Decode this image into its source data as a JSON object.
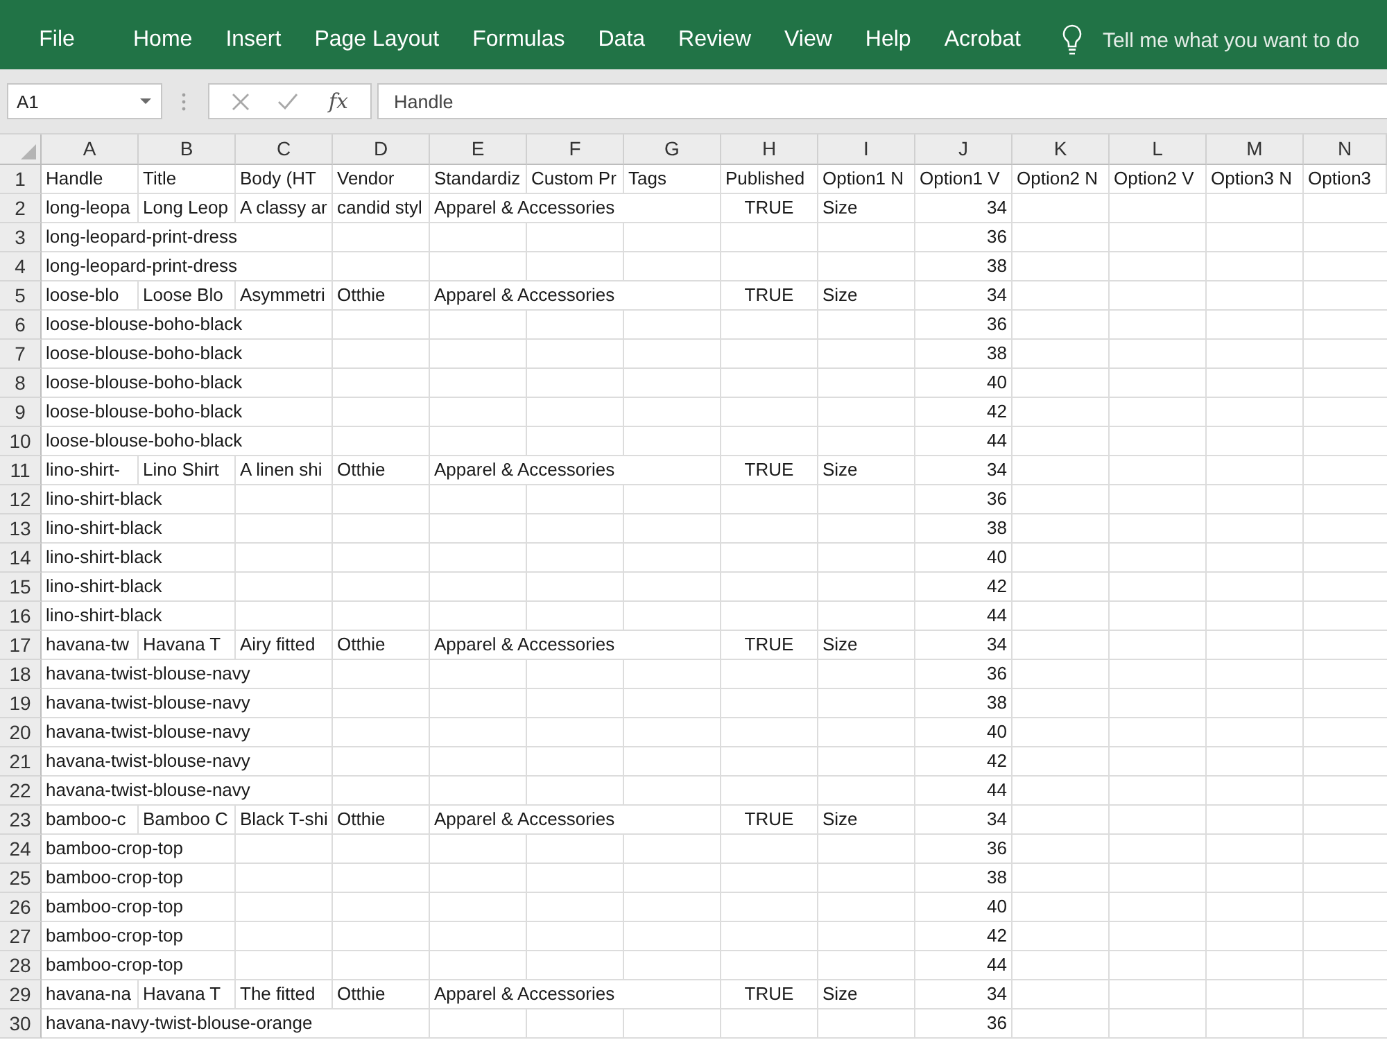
{
  "ribbon": {
    "tabs": [
      "File",
      "Home",
      "Insert",
      "Page Layout",
      "Formulas",
      "Data",
      "Review",
      "View",
      "Help",
      "Acrobat"
    ],
    "tell_me": {
      "placeholder": "Tell me what you want to do"
    }
  },
  "formula_bar": {
    "name_box": "A1",
    "function_label": "fx",
    "formula": "Handle"
  },
  "sheet": {
    "columns": [
      "A",
      "B",
      "C",
      "D",
      "E",
      "F",
      "G",
      "H",
      "I",
      "J",
      "K",
      "L",
      "M",
      "N"
    ],
    "rows": [
      {
        "number": "1",
        "cells": {
          "A": {
            "text": "Handle",
            "kind": "text"
          },
          "B": {
            "text": "Title",
            "kind": "text"
          },
          "C": {
            "text": "Body (HT",
            "kind": "text"
          },
          "D": {
            "text": "Vendor",
            "kind": "text"
          },
          "E": {
            "text": "Standardiz",
            "kind": "text"
          },
          "F": {
            "text": "Custom Pr",
            "kind": "text"
          },
          "G": {
            "text": "Tags",
            "kind": "text"
          },
          "H": {
            "text": "Published",
            "kind": "text"
          },
          "I": {
            "text": "Option1 N",
            "kind": "text"
          },
          "J": {
            "text": "Option1 V",
            "kind": "text"
          },
          "K": {
            "text": "Option2 N",
            "kind": "text"
          },
          "L": {
            "text": "Option2 V",
            "kind": "text"
          },
          "M": {
            "text": "Option3 N",
            "kind": "text"
          },
          "N": {
            "text": "Option3",
            "kind": "text"
          }
        }
      },
      {
        "number": "2",
        "cells": {
          "A": {
            "text": "long-leopa",
            "kind": "text"
          },
          "B": {
            "text": "Long Leop",
            "kind": "text"
          },
          "C": {
            "text": "A classy ar",
            "kind": "text"
          },
          "D": {
            "text": "candid styl",
            "kind": "text"
          },
          "E": {
            "text": "Apparel & Accessories",
            "kind": "text"
          },
          "H": {
            "text": "TRUE",
            "kind": "boolean"
          },
          "I": {
            "text": "Size",
            "kind": "text"
          },
          "J": {
            "text": "34",
            "kind": "number"
          }
        }
      },
      {
        "number": "3",
        "cells": {
          "A": {
            "text": "long-leopard-print-dress",
            "kind": "text"
          },
          "J": {
            "text": "36",
            "kind": "number"
          }
        }
      },
      {
        "number": "4",
        "cells": {
          "A": {
            "text": "long-leopard-print-dress",
            "kind": "text"
          },
          "J": {
            "text": "38",
            "kind": "number"
          }
        }
      },
      {
        "number": "5",
        "cells": {
          "A": {
            "text": "loose-blo",
            "kind": "text"
          },
          "B": {
            "text": "Loose Blo",
            "kind": "text"
          },
          "C": {
            "text": "Asymmetri",
            "kind": "text"
          },
          "D": {
            "text": "Otthie",
            "kind": "text"
          },
          "E": {
            "text": "Apparel & Accessories",
            "kind": "text"
          },
          "H": {
            "text": "TRUE",
            "kind": "boolean"
          },
          "I": {
            "text": "Size",
            "kind": "text"
          },
          "J": {
            "text": "34",
            "kind": "number"
          }
        }
      },
      {
        "number": "6",
        "cells": {
          "A": {
            "text": "loose-blouse-boho-black",
            "kind": "text"
          },
          "J": {
            "text": "36",
            "kind": "number"
          }
        }
      },
      {
        "number": "7",
        "cells": {
          "A": {
            "text": "loose-blouse-boho-black",
            "kind": "text"
          },
          "J": {
            "text": "38",
            "kind": "number"
          }
        }
      },
      {
        "number": "8",
        "cells": {
          "A": {
            "text": "loose-blouse-boho-black",
            "kind": "text"
          },
          "J": {
            "text": "40",
            "kind": "number"
          }
        }
      },
      {
        "number": "9",
        "cells": {
          "A": {
            "text": "loose-blouse-boho-black",
            "kind": "text"
          },
          "J": {
            "text": "42",
            "kind": "number"
          }
        }
      },
      {
        "number": "10",
        "cells": {
          "A": {
            "text": "loose-blouse-boho-black",
            "kind": "text"
          },
          "J": {
            "text": "44",
            "kind": "number"
          }
        }
      },
      {
        "number": "11",
        "cells": {
          "A": {
            "text": "lino-shirt-",
            "kind": "text"
          },
          "B": {
            "text": "Lino Shirt",
            "kind": "text"
          },
          "C": {
            "text": "A linen shi",
            "kind": "text"
          },
          "D": {
            "text": "Otthie",
            "kind": "text"
          },
          "E": {
            "text": "Apparel & Accessories",
            "kind": "text"
          },
          "H": {
            "text": "TRUE",
            "kind": "boolean"
          },
          "I": {
            "text": "Size",
            "kind": "text"
          },
          "J": {
            "text": "34",
            "kind": "number"
          }
        }
      },
      {
        "number": "12",
        "cells": {
          "A": {
            "text": "lino-shirt-black",
            "kind": "text"
          },
          "J": {
            "text": "36",
            "kind": "number"
          }
        }
      },
      {
        "number": "13",
        "cells": {
          "A": {
            "text": "lino-shirt-black",
            "kind": "text"
          },
          "J": {
            "text": "38",
            "kind": "number"
          }
        }
      },
      {
        "number": "14",
        "cells": {
          "A": {
            "text": "lino-shirt-black",
            "kind": "text"
          },
          "J": {
            "text": "40",
            "kind": "number"
          }
        }
      },
      {
        "number": "15",
        "cells": {
          "A": {
            "text": "lino-shirt-black",
            "kind": "text"
          },
          "J": {
            "text": "42",
            "kind": "number"
          }
        }
      },
      {
        "number": "16",
        "cells": {
          "A": {
            "text": "lino-shirt-black",
            "kind": "text"
          },
          "J": {
            "text": "44",
            "kind": "number"
          }
        }
      },
      {
        "number": "17",
        "cells": {
          "A": {
            "text": "havana-tw",
            "kind": "text"
          },
          "B": {
            "text": "Havana T",
            "kind": "text"
          },
          "C": {
            "text": "Airy fitted",
            "kind": "text"
          },
          "D": {
            "text": "Otthie",
            "kind": "text"
          },
          "E": {
            "text": "Apparel & Accessories",
            "kind": "text"
          },
          "H": {
            "text": "TRUE",
            "kind": "boolean"
          },
          "I": {
            "text": "Size",
            "kind": "text"
          },
          "J": {
            "text": "34",
            "kind": "number"
          }
        }
      },
      {
        "number": "18",
        "cells": {
          "A": {
            "text": "havana-twist-blouse-navy",
            "kind": "text"
          },
          "J": {
            "text": "36",
            "kind": "number"
          }
        }
      },
      {
        "number": "19",
        "cells": {
          "A": {
            "text": "havana-twist-blouse-navy",
            "kind": "text"
          },
          "J": {
            "text": "38",
            "kind": "number"
          }
        }
      },
      {
        "number": "20",
        "cells": {
          "A": {
            "text": "havana-twist-blouse-navy",
            "kind": "text"
          },
          "J": {
            "text": "40",
            "kind": "number"
          }
        }
      },
      {
        "number": "21",
        "cells": {
          "A": {
            "text": "havana-twist-blouse-navy",
            "kind": "text"
          },
          "J": {
            "text": "42",
            "kind": "number"
          }
        }
      },
      {
        "number": "22",
        "cells": {
          "A": {
            "text": "havana-twist-blouse-navy",
            "kind": "text"
          },
          "J": {
            "text": "44",
            "kind": "number"
          }
        }
      },
      {
        "number": "23",
        "cells": {
          "A": {
            "text": "bamboo-c",
            "kind": "text"
          },
          "B": {
            "text": "Bamboo C",
            "kind": "text"
          },
          "C": {
            "text": "Black T-shi",
            "kind": "text"
          },
          "D": {
            "text": "Otthie",
            "kind": "text"
          },
          "E": {
            "text": "Apparel & Accessories",
            "kind": "text"
          },
          "H": {
            "text": "TRUE",
            "kind": "boolean"
          },
          "I": {
            "text": "Size",
            "kind": "text"
          },
          "J": {
            "text": "34",
            "kind": "number"
          }
        }
      },
      {
        "number": "24",
        "cells": {
          "A": {
            "text": "bamboo-crop-top",
            "kind": "text"
          },
          "J": {
            "text": "36",
            "kind": "number"
          }
        }
      },
      {
        "number": "25",
        "cells": {
          "A": {
            "text": "bamboo-crop-top",
            "kind": "text"
          },
          "J": {
            "text": "38",
            "kind": "number"
          }
        }
      },
      {
        "number": "26",
        "cells": {
          "A": {
            "text": "bamboo-crop-top",
            "kind": "text"
          },
          "J": {
            "text": "40",
            "kind": "number"
          }
        }
      },
      {
        "number": "27",
        "cells": {
          "A": {
            "text": "bamboo-crop-top",
            "kind": "text"
          },
          "J": {
            "text": "42",
            "kind": "number"
          }
        }
      },
      {
        "number": "28",
        "cells": {
          "A": {
            "text": "bamboo-crop-top",
            "kind": "text"
          },
          "J": {
            "text": "44",
            "kind": "number"
          }
        }
      },
      {
        "number": "29",
        "cells": {
          "A": {
            "text": "havana-na",
            "kind": "text"
          },
          "B": {
            "text": "Havana T",
            "kind": "text"
          },
          "C": {
            "text": "The fitted",
            "kind": "text"
          },
          "D": {
            "text": "Otthie",
            "kind": "text"
          },
          "E": {
            "text": "Apparel & Accessories",
            "kind": "text"
          },
          "H": {
            "text": "TRUE",
            "kind": "boolean"
          },
          "I": {
            "text": "Size",
            "kind": "text"
          },
          "J": {
            "text": "34",
            "kind": "number"
          }
        }
      },
      {
        "number": "30",
        "cells": {
          "A": {
            "text": "havana-navy-twist-blouse-orange",
            "kind": "text"
          },
          "J": {
            "text": "36",
            "kind": "number"
          }
        }
      }
    ]
  }
}
